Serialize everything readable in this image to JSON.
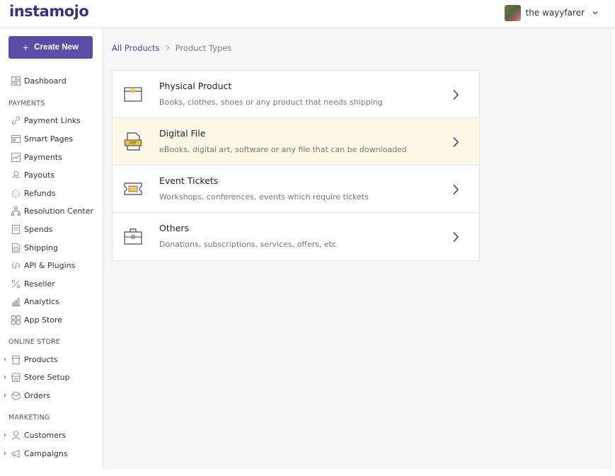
{
  "brand": {
    "logo_text": "instamojo"
  },
  "user": {
    "name": "the wayyfarer"
  },
  "sidebar": {
    "create_label": "Create New",
    "dashboard": "Dashboard",
    "sections": {
      "payments": "PAYMENTS",
      "online_store": "ONLINE STORE",
      "marketing": "MARKETING"
    },
    "payments_items": [
      "Payment Links",
      "Smart Pages",
      "Payments",
      "Payouts",
      "Refunds",
      "Resolution Center",
      "Spends",
      "Shipping",
      "API & Plugins",
      "Reseller",
      "Analytics",
      "App Store"
    ],
    "store_items": [
      "Products",
      "Store Setup",
      "Orders"
    ],
    "marketing_items": [
      "Customers",
      "Campaigns"
    ]
  },
  "breadcrumb": {
    "root": "All Products",
    "separator": ">",
    "current": "Product Types"
  },
  "product_types": [
    {
      "title": "Physical Product",
      "description": "Books, clothes, shoes or any product that needs shipping",
      "icon": "box-icon"
    },
    {
      "title": "Digital File",
      "description": "eBooks, digital art, software or any file that can be downloaded",
      "icon": "pdf-file-icon"
    },
    {
      "title": "Event Tickets",
      "description": "Workshops, conferences, events which require tickets",
      "icon": "ticket-icon"
    },
    {
      "title": "Others",
      "description": "Donations, subscriptions, services, offers, etc",
      "icon": "briefcase-icon"
    }
  ],
  "colors": {
    "brand": "#3a2f80",
    "button": "#5b4ba5",
    "highlight": "#fdf8e6",
    "accent_yellow": "#f2c230"
  }
}
